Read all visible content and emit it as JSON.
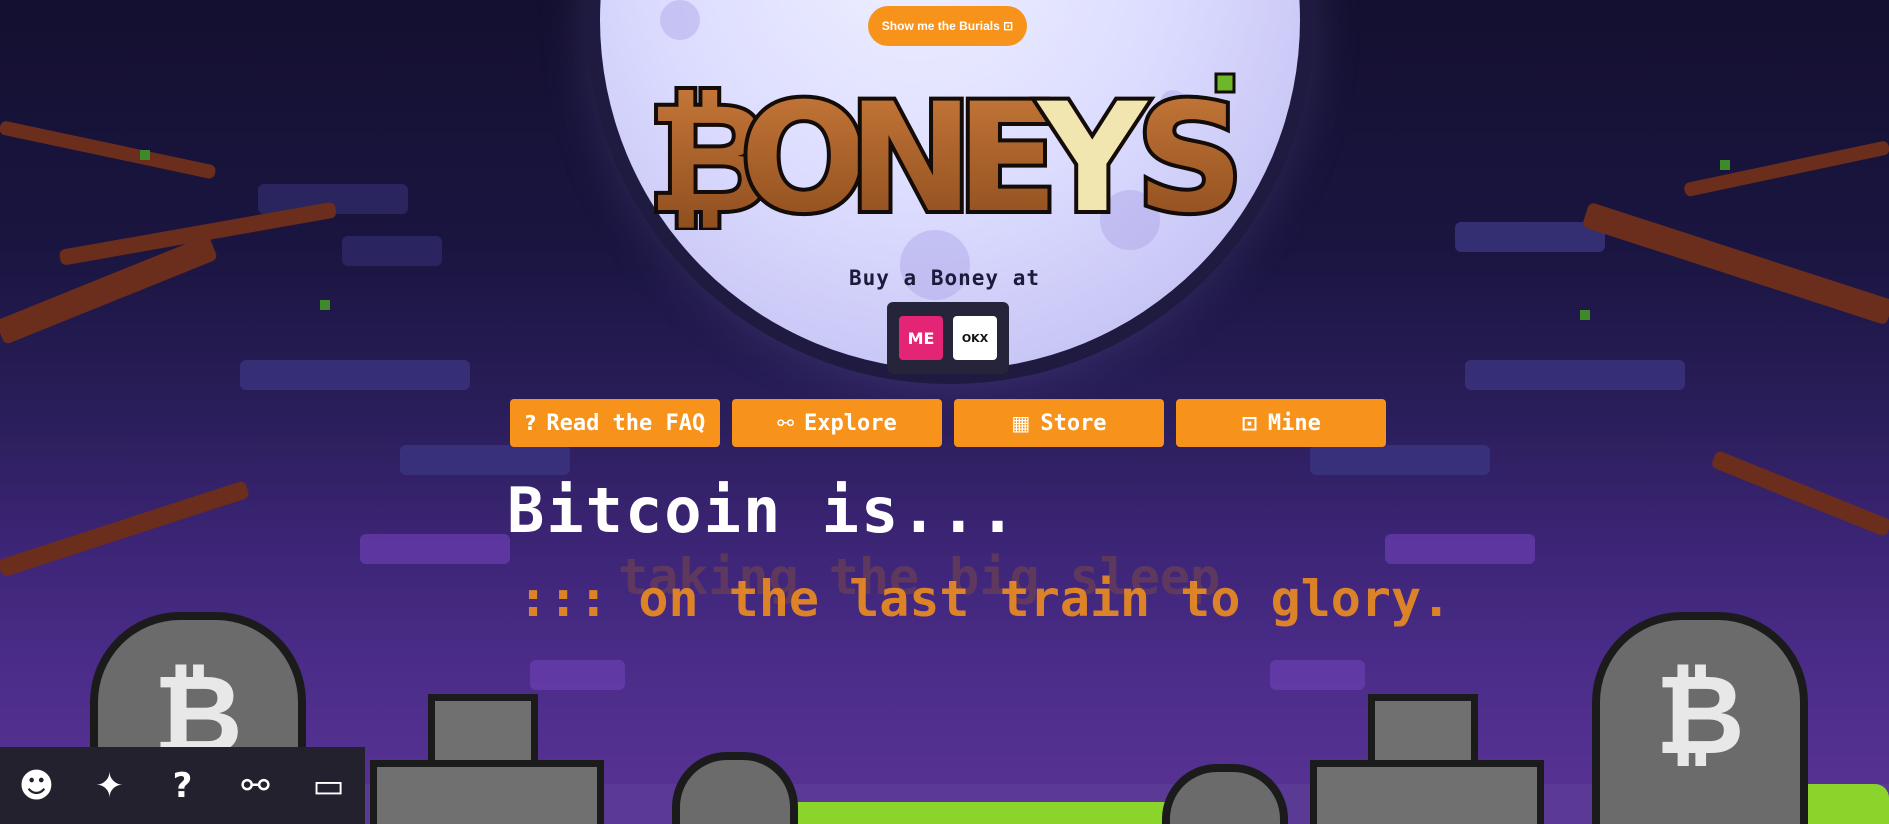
{
  "header": {
    "burials_button_label": "Show me the Burials ⊡"
  },
  "logo": {
    "text": "BONEYS"
  },
  "buy": {
    "label": "Buy a Boney at",
    "markets": [
      {
        "name": "magic-eden",
        "mark": "ME"
      },
      {
        "name": "okx",
        "mark": "OKX"
      }
    ]
  },
  "nav": [
    {
      "label": "Read the FAQ",
      "icon": "?"
    },
    {
      "label": "Explore",
      "icon": "⚯"
    },
    {
      "label": "Store",
      "icon": "▦"
    },
    {
      "label": "Mine",
      "icon": "⊡"
    }
  ],
  "hero": {
    "prefix": "Bitcoin is...",
    "ghost_phrase": "taking the big sleep",
    "phrase": "::: on the last train to glory."
  },
  "social": [
    {
      "name": "discord-icon",
      "glyph": "☻"
    },
    {
      "name": "twitter-icon",
      "glyph": "✦"
    },
    {
      "name": "help-icon",
      "glyph": "?"
    },
    {
      "name": "binoculars-icon",
      "glyph": "⚯"
    },
    {
      "name": "tape-icon",
      "glyph": "▭"
    }
  ],
  "colors": {
    "accent": "#f7931a",
    "sky": "#141030",
    "moon": "#dcdcff",
    "grass": "#8ad42c"
  }
}
